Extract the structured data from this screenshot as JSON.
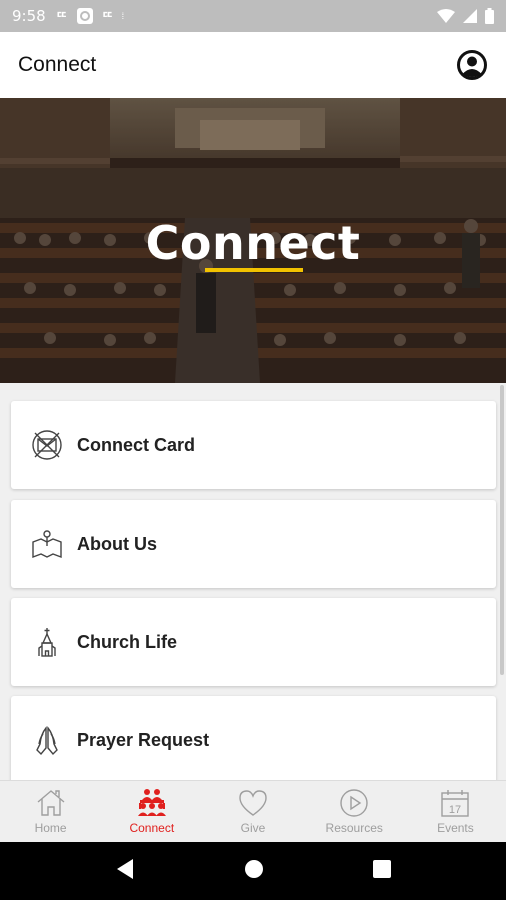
{
  "status_bar": {
    "time": "9:58"
  },
  "app_bar": {
    "title": "Connect"
  },
  "hero": {
    "title": "Connect"
  },
  "menu": {
    "items": [
      {
        "label": "Connect Card",
        "icon": "envelope-x-icon"
      },
      {
        "label": "About Us",
        "icon": "map-pin-icon"
      },
      {
        "label": "Church Life",
        "icon": "church-icon"
      },
      {
        "label": "Prayer Request",
        "icon": "praying-hands-icon"
      }
    ]
  },
  "tabs": [
    {
      "label": "Home",
      "icon": "home-icon",
      "active": false
    },
    {
      "label": "Connect",
      "icon": "people-icon",
      "active": true
    },
    {
      "label": "Give",
      "icon": "heart-icon",
      "active": false
    },
    {
      "label": "Resources",
      "icon": "play-circle-icon",
      "active": false
    },
    {
      "label": "Events",
      "icon": "calendar-icon",
      "active": false
    }
  ],
  "events_calendar_day": "17",
  "colors": {
    "accent": "#e0201e",
    "underline": "#f2c200",
    "inactive": "#9e9e9e"
  }
}
